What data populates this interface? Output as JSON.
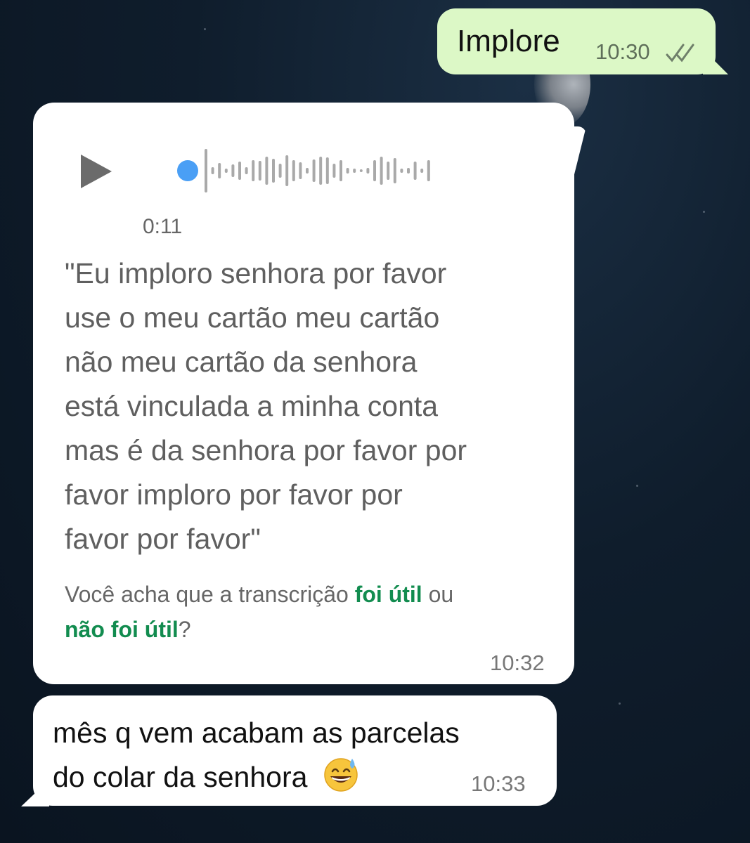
{
  "messages": {
    "outgoing": {
      "text": "Implore",
      "time": "10:30",
      "status_icon": "double-check-icon"
    },
    "voice": {
      "play_icon": "play-icon",
      "duration": "0:11",
      "transcript_lines": [
        "\"Eu imploro senhora por favor",
        "use o meu cartão meu cartão",
        "não meu cartão da senhora",
        "está vinculada a minha conta",
        "mas é da senhora por favor por",
        "favor imploro por favor por",
        "favor por favor\""
      ],
      "feedback_prefix": "Você acha que a transcrição ",
      "feedback_yes": "foi útil",
      "feedback_mid": " ou",
      "feedback_no": "não foi útil",
      "feedback_suffix": "?",
      "time": "10:32"
    },
    "incoming": {
      "line1": "mês q vem acabam as parcelas",
      "line2": "do colar da senhora",
      "emoji": "grinning-sweat-emoji",
      "time": "10:33"
    }
  },
  "colors": {
    "outgoing_bubble": "#dcf8c6",
    "incoming_bubble": "#ffffff",
    "link": "#128c4f",
    "progress_dot": "#4a9ff5"
  }
}
